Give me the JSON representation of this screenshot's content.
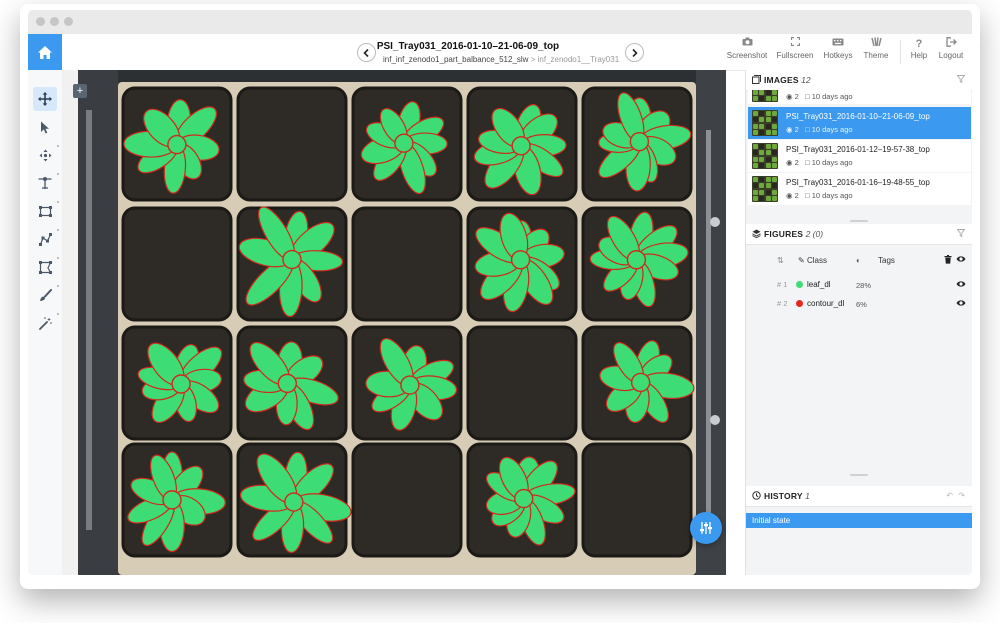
{
  "topbar": {
    "image_title": "PSI_Tray031_2016-01-10–21-06-09_top",
    "breadcrumb_project": "inf_inf_zenodo1_part_balbance_512_slw",
    "breadcrumb_sep": ">",
    "breadcrumb_dataset": "inf_zenodo1__Tray031",
    "buttons": {
      "screenshot": "Screenshot",
      "fullscreen": "Fullscreen",
      "hotkeys": "Hotkeys",
      "theme": "Theme",
      "help": "Help",
      "logout": "Logout"
    }
  },
  "tools": [
    "move-tool",
    "select-tool",
    "drag-tool",
    "point-tool",
    "rectangle-tool",
    "polyline-tool",
    "polygon-tool",
    "brush-tool",
    "magic-wand-tool"
  ],
  "images": {
    "title": "IMAGES",
    "count": "12",
    "partial": {
      "figures": "2",
      "time": "10 days ago"
    },
    "items": [
      {
        "name": "PSI_Tray031_2016-01-10–21-06-09_top",
        "figures": "2",
        "time": "10 days ago",
        "selected": true
      },
      {
        "name": "PSI_Tray031_2016-01-12–19-57-38_top",
        "figures": "2",
        "time": "10 days ago",
        "selected": false
      },
      {
        "name": "PSI_Tray031_2016-01-16–19-48-55_top",
        "figures": "2",
        "time": "10 days ago",
        "selected": false
      }
    ]
  },
  "figures": {
    "title": "FIGURES",
    "count": "2 (0)",
    "col_class": "Class",
    "col_tags": "Tags",
    "rows": [
      {
        "num": "# 1",
        "name": "leaf_dl",
        "pct": "28%",
        "color": "#3ddc74"
      },
      {
        "num": "# 2",
        "name": "contour_dl",
        "pct": "6%",
        "color": "#e8261f"
      }
    ]
  },
  "history": {
    "title": "HISTORY",
    "count": "1",
    "items": [
      "Initial state"
    ]
  },
  "colors": {
    "accent": "#3b99f0",
    "leaf": "#3ddc74",
    "contour": "#d0281c"
  }
}
